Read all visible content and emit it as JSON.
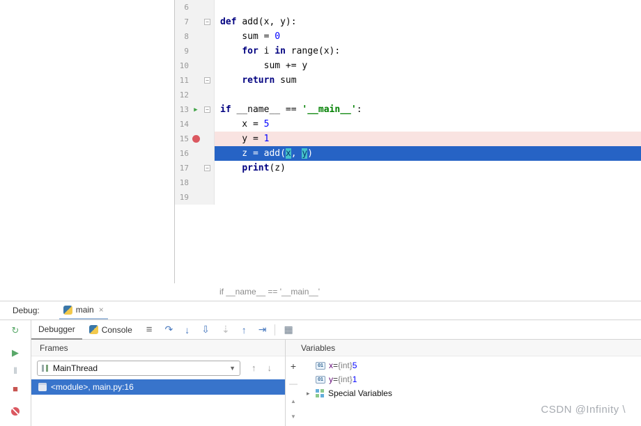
{
  "colors": {
    "execution_line": "#2663C5",
    "breakpoint_line": "#F9E3E1",
    "selection_blue": "#3874CB",
    "breakpoint_red": "#DB5860",
    "run_green": "#59A869",
    "highlight_teal": "#45C2CB"
  },
  "editor": {
    "breadcrumb": "if __name__ == '__main__'",
    "lines": [
      {
        "num": "6",
        "tokens": []
      },
      {
        "num": "7",
        "fold": true,
        "tokens": [
          [
            "def ",
            "kw"
          ],
          [
            "add(x, y):",
            "pl"
          ]
        ]
      },
      {
        "num": "8",
        "tokens": [
          [
            "    sum = ",
            "pl"
          ],
          [
            "0",
            "num"
          ]
        ]
      },
      {
        "num": "9",
        "tokens": [
          [
            "    ",
            "pl"
          ],
          [
            "for ",
            "kw"
          ],
          [
            "i ",
            "pl"
          ],
          [
            "in ",
            "kw"
          ],
          [
            "range(x):",
            "pl"
          ]
        ]
      },
      {
        "num": "10",
        "tokens": [
          [
            "        sum += y",
            "pl"
          ]
        ]
      },
      {
        "num": "11",
        "fold": true,
        "tokens": [
          [
            "    ",
            "pl"
          ],
          [
            "return ",
            "kw"
          ],
          [
            "sum",
            "pl"
          ]
        ]
      },
      {
        "num": "12",
        "tokens": []
      },
      {
        "num": "13",
        "fold": true,
        "icon": "arrow",
        "tokens": [
          [
            "if ",
            "kw"
          ],
          [
            "__name__ == ",
            "pl"
          ],
          [
            "'__main__'",
            "str"
          ],
          [
            ":",
            "pl"
          ]
        ]
      },
      {
        "num": "14",
        "tokens": [
          [
            "    x = ",
            "pl"
          ],
          [
            "5",
            "num"
          ]
        ]
      },
      {
        "num": "15",
        "icon": "breakpoint",
        "variant": "bp",
        "tokens": [
          [
            "    y = ",
            "pl"
          ],
          [
            "1",
            "num"
          ]
        ]
      },
      {
        "num": "16",
        "variant": "exec",
        "tokens": [
          [
            "    z = add(",
            "pl"
          ],
          [
            "x",
            "hl"
          ],
          [
            ", ",
            "pl"
          ],
          [
            "y",
            "hl"
          ],
          [
            ")",
            "pl"
          ]
        ]
      },
      {
        "num": "17",
        "fold": true,
        "tokens": [
          [
            "    ",
            "pl"
          ],
          [
            "print",
            "kw"
          ],
          [
            "(z)",
            "pl"
          ]
        ]
      },
      {
        "num": "18",
        "tokens": []
      },
      {
        "num": "19",
        "tokens": []
      }
    ]
  },
  "debug": {
    "window_label": "Debug:",
    "session_tab": {
      "label": "main",
      "close": "×"
    },
    "toolbar": {
      "debugger_tab": "Debugger",
      "console_tab": "Console",
      "menu_glyph": "≡",
      "steps": [
        {
          "name": "step-over",
          "glyph": "↷"
        },
        {
          "name": "step-into",
          "glyph": "↓"
        },
        {
          "name": "step-into-my-code",
          "glyph": "⇩"
        },
        {
          "name": "force-step-into",
          "glyph": "⇣",
          "disabled": true
        },
        {
          "name": "step-out",
          "glyph": "↑"
        },
        {
          "name": "run-to-cursor",
          "glyph": "⇥"
        }
      ],
      "layout_glyph": "▦"
    },
    "left_toolbar": [
      {
        "name": "rerun",
        "glyph": "↻",
        "color": "#59A869"
      },
      {
        "name": "resume",
        "glyph": "▶",
        "color": "#59A869"
      },
      {
        "name": "pause",
        "glyph": "‖",
        "color": "#9AA7B0"
      },
      {
        "name": "stop",
        "glyph": "■",
        "color": "#C75450"
      },
      {
        "name": "mute-breakpoints",
        "glyph": "",
        "color": "#DB5860"
      }
    ],
    "frames": {
      "title": "Frames",
      "thread_selector": "MainThread",
      "rows": [
        {
          "label": "<module>, main.py:16",
          "selected": true
        }
      ]
    },
    "variables": {
      "title": "Variables",
      "rows": [
        {
          "kind": "var",
          "name": "x",
          "eq": " = ",
          "type": "{int} ",
          "value": "5"
        },
        {
          "kind": "var",
          "name": "y",
          "eq": " = ",
          "type": "{int} ",
          "value": "1"
        },
        {
          "kind": "group",
          "label": "Special Variables"
        }
      ]
    }
  },
  "watermark": "CSDN @Infinity \\"
}
